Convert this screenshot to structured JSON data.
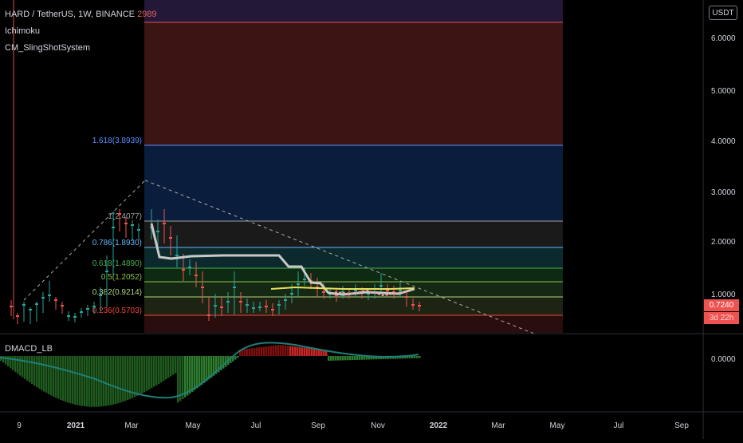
{
  "header": {
    "symbol_line": "HARD / TetherUS, 1W, BINANCE",
    "symbol_value_fragment": "2989",
    "indicator_1": "Ichimoku",
    "indicator_2": "CM_SlingShotSystem",
    "lower_indicator": "DMACD_LB"
  },
  "currency_label": "USDT",
  "price_axis": {
    "ticks": [
      "6.0000",
      "5.0000",
      "4.0000",
      "3.0000",
      "2.0000",
      "1.0000"
    ],
    "lower_pane_tick": "0.0000",
    "current_price": "0.7240",
    "countdown": "3d 22h"
  },
  "time_axis": {
    "ticks": [
      "9",
      "2021",
      "Mar",
      "May",
      "Jul",
      "Sep",
      "Nov",
      "2022",
      "Mar",
      "May",
      "Jul",
      "Sep"
    ]
  },
  "fib_levels": [
    {
      "label": "1.618(3.8939)",
      "value": 3.8939,
      "color": "#5b8dff"
    },
    {
      "label": "1(2.4077)",
      "value": 2.4077,
      "color": "#9e9e9e"
    },
    {
      "label": "0.786(1.8930)",
      "value": 1.893,
      "color": "#64b5f6"
    },
    {
      "label": "0.618(1.4890)",
      "value": 1.489,
      "color": "#4caf50"
    },
    {
      "label": "0.5(1.2052)",
      "value": 1.2052,
      "color": "#8bc34a"
    },
    {
      "label": "0.382(0.9214)",
      "value": 0.9214,
      "color": "#aed581"
    },
    {
      "label": "0.236(0.5703)",
      "value": 0.5703,
      "color": "#f44336"
    }
  ],
  "colors": {
    "up_candle": "#26a69a",
    "down_candle": "#ef5350",
    "fib_red_zone": "#5a1d1d",
    "fib_blue_zone": "#0d2147",
    "ichimoku_line": "#c8c8c8",
    "macd_line": "#1e7f7a"
  }
}
